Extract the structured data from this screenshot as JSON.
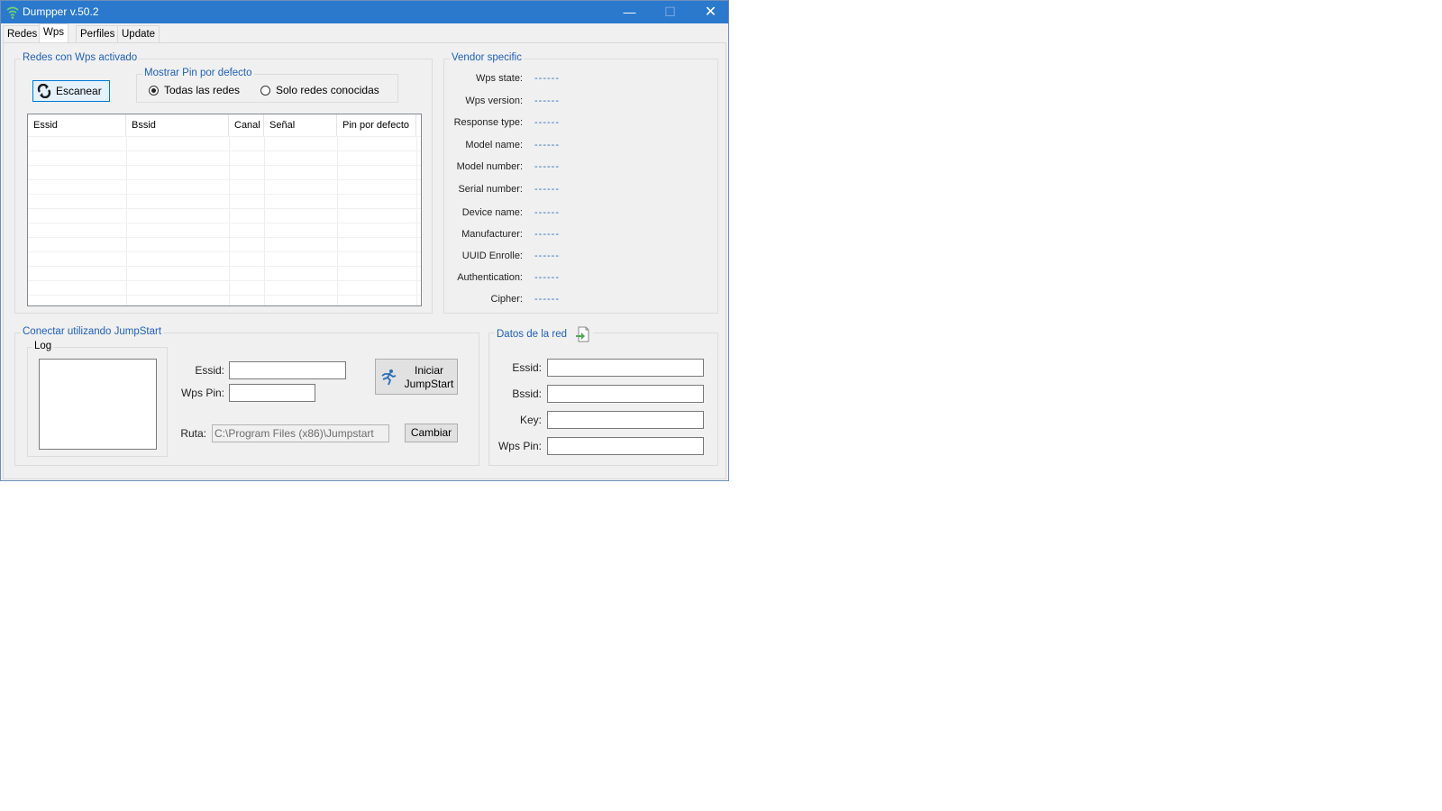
{
  "window": {
    "title": "Dumpper v.50.2",
    "controls": {
      "minimize": "—",
      "maximize": "☐",
      "close": "✕"
    }
  },
  "tabs": [
    {
      "label": "Redes",
      "active": false
    },
    {
      "label": "Wps",
      "active": true
    },
    {
      "label": "Perfiles",
      "active": false
    },
    {
      "label": "Update",
      "active": false
    }
  ],
  "wps_group": {
    "title": "Redes con Wps activado",
    "scan_button": "Escanear",
    "pin_group": {
      "title": "Mostrar Pin por defecto",
      "options": [
        {
          "label": "Todas las redes",
          "checked": true
        },
        {
          "label": "Solo redes conocidas",
          "checked": false
        }
      ]
    },
    "list": {
      "columns": [
        "Essid",
        "Bssid",
        "Canal",
        "Señal",
        "Pin por defecto"
      ],
      "rows": []
    }
  },
  "vendor_group": {
    "title": "Vendor specific",
    "fields": [
      {
        "label": "Wps state:",
        "value": "------"
      },
      {
        "label": "Wps version:",
        "value": "------"
      },
      {
        "label": "Response type:",
        "value": "------"
      },
      {
        "label": "Model name:",
        "value": "------"
      },
      {
        "label": "Model number:",
        "value": "------"
      },
      {
        "label": "Serial number:",
        "value": "------"
      },
      {
        "label": "Device name:",
        "value": "------"
      },
      {
        "label": "Manufacturer:",
        "value": "------"
      },
      {
        "label": "UUID Enrolle:",
        "value": "------"
      },
      {
        "label": "Authentication:",
        "value": "------"
      },
      {
        "label": "Cipher:",
        "value": "------"
      }
    ]
  },
  "jumpstart_group": {
    "title": "Conectar utilizando JumpStart",
    "log_title": "Log",
    "essid_label": "Essid:",
    "essid_value": "",
    "wpspin_label": "Wps Pin:",
    "wpspin_value": "",
    "start_button_line1": "Iniciar",
    "start_button_line2": "JumpStart",
    "ruta_label": "Ruta:",
    "ruta_value": "C:\\Program Files (x86)\\Jumpstart",
    "change_button": "Cambiar"
  },
  "network_group": {
    "title": "Datos de la red",
    "fields": [
      {
        "label": "Essid:",
        "value": ""
      },
      {
        "label": "Bssid:",
        "value": ""
      },
      {
        "label": "Key:",
        "value": ""
      },
      {
        "label": "Wps Pin:",
        "value": ""
      }
    ]
  },
  "colors": {
    "titlebar": "#2b79cd",
    "group_title": "#1f5fb8",
    "vendor_value": "#2a6fb8"
  }
}
